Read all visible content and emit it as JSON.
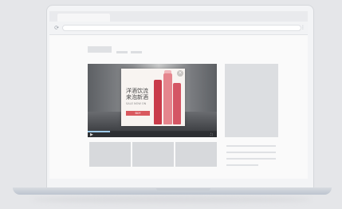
{
  "browser": {
    "tab_title": "",
    "url": "",
    "nav_icon": "refresh-icon",
    "menu_icon": "menu-icon"
  },
  "video": {
    "state": "playing",
    "progress": 0.17,
    "time": "",
    "play_icon": "play-icon",
    "fullscreen_icon": "fullscreen-icon"
  },
  "ad": {
    "line1": "洋酒饮流",
    "line2": "来泡新酒",
    "line3": "SALE NOW ON",
    "button": "BUY",
    "close_icon": "close-icon",
    "accent": "#d9595f"
  },
  "colors": {
    "background": "#e5e6e9",
    "accent": "#d9595f"
  }
}
